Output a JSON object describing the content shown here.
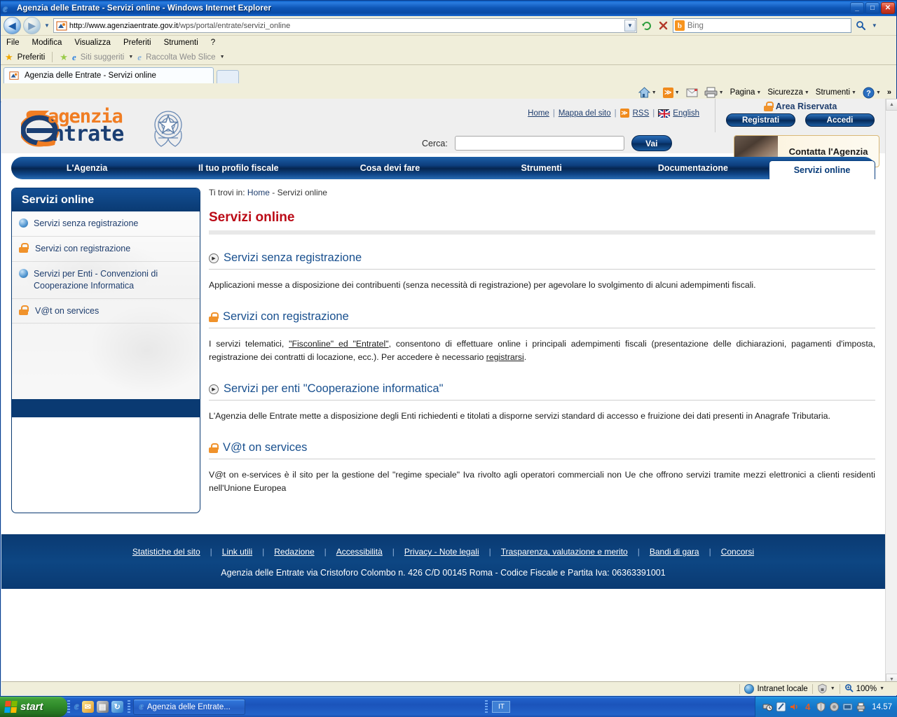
{
  "window": {
    "title": "Agenzia delle Entrate - Servizi online - Windows Internet Explorer",
    "minimize": "_",
    "maximize": "□",
    "close": "✕"
  },
  "browser": {
    "back_icon": "◀",
    "forward_icon": "▶",
    "url_prefix": "http://www.agenziaentrate.gov.it",
    "url_suffix": "/wps/portal/entrate/servizi_online",
    "refresh_icon": "↻",
    "stop_icon": "✕",
    "search_placeholder": "Bing",
    "search_value": "",
    "search_go_icon": "🔍",
    "menus": [
      "File",
      "Modifica",
      "Visualizza",
      "Preferiti",
      "Strumenti",
      "?"
    ],
    "favorites_bar": {
      "preferiti": "Preferiti",
      "siti_suggeriti": "Siti suggeriti",
      "raccolta_web_slice": "Raccolta Web Slice"
    },
    "tab_label": "Agenzia delle Entrate - Servizi online",
    "command_bar": [
      "Pagina",
      "Sicurezza",
      "Strumenti"
    ],
    "status": {
      "zone": "Intranet locale",
      "zoom": "100%"
    }
  },
  "site": {
    "logo": {
      "part1": "agenzia",
      "part2": "ntrate",
      "initial": "e"
    },
    "top_links": {
      "home": "Home",
      "mappa": "Mappa del sito",
      "rss": "RSS",
      "english": "English"
    },
    "search": {
      "label": "Cerca:",
      "value": "",
      "placeholder": "",
      "button": "Vai"
    },
    "reserved_area": {
      "title": "Area Riservata",
      "register": "Registrati",
      "login": "Accedi"
    },
    "contact": {
      "label": "Contatta l'Agenzia"
    },
    "nav": [
      {
        "label": "L'Agenzia",
        "active": false
      },
      {
        "label": "Il tuo profilo fiscale",
        "active": false
      },
      {
        "label": "Cosa devi fare",
        "active": false
      },
      {
        "label": "Strumenti",
        "active": false
      },
      {
        "label": "Documentazione",
        "active": false
      },
      {
        "label": "Servizi online",
        "active": true
      }
    ],
    "sidebar": {
      "title": "Servizi online",
      "items": [
        {
          "label": "Servizi senza registrazione",
          "icon": "blue-bullet-icon"
        },
        {
          "label": "Servizi con registrazione",
          "icon": "lock-icon"
        },
        {
          "label": "Servizi per Enti - Convenzioni di Cooperazione Informatica",
          "icon": "blue-bullet-icon"
        },
        {
          "label": "V@t on services",
          "icon": "lock-icon"
        }
      ]
    },
    "breadcrumb": {
      "prefix": "Ti trovi in:",
      "home": "Home",
      "separator": "-",
      "current": "Servizi online"
    },
    "page_title": "Servizi online",
    "sections": [
      {
        "icon": "play-circle-icon",
        "heading": "Servizi senza registrazione",
        "body": "Applicazioni messe a disposizione dei contribuenti (senza necessità di registrazione) per agevolare lo svolgimento di alcuni adempimenti fiscali."
      },
      {
        "icon": "lock-icon",
        "heading": "Servizi con registrazione",
        "body_pre": "I servizi telematici, ",
        "body_link1": "\"Fisconline\" ed \"Entratel\"",
        "body_mid": ", consentono di effettuare online i principali adempimenti fiscali (presentazione delle dichiarazioni, pagamenti d'imposta, registrazione dei contratti di locazione, ecc.). Per accedere è necessario ",
        "body_link2": "registrarsi",
        "body_post": "."
      },
      {
        "icon": "play-circle-icon",
        "heading": "Servizi per enti \"Cooperazione informatica\"",
        "body": "L'Agenzia delle Entrate mette a disposizione degli Enti richiedenti e titolati a disporne servizi standard di accesso e fruizione dei dati presenti in Anagrafe Tributaria."
      },
      {
        "icon": "lock-icon",
        "heading": "V@t on services",
        "body": "V@t on e-services è il sito per la gestione del \"regime speciale\" Iva rivolto agli operatori commerciali non Ue che offrono servizi tramite mezzi elettronici a clienti residenti nell'Unione Europea"
      }
    ],
    "footer": {
      "links": [
        "Statistiche del sito",
        "Link utili",
        "Redazione",
        "Accessibilità",
        "Privacy - Note legali",
        "Trasparenza, valutazione e merito",
        "Bandi di gara",
        "Concorsi"
      ],
      "address": "Agenzia delle Entrate via Cristoforo Colombo n. 426 C/D 00145 Roma - Codice Fiscale e Partita Iva: 06363391001"
    }
  },
  "taskbar": {
    "start": "start",
    "task_label": "Agenzia delle Entrate...",
    "language": "IT",
    "time": "14.57"
  },
  "colors": {
    "brand_blue": "#0a3a72",
    "brand_orange": "#f07d23",
    "title_red": "#bb0b17",
    "heading_blue": "#19508f"
  }
}
